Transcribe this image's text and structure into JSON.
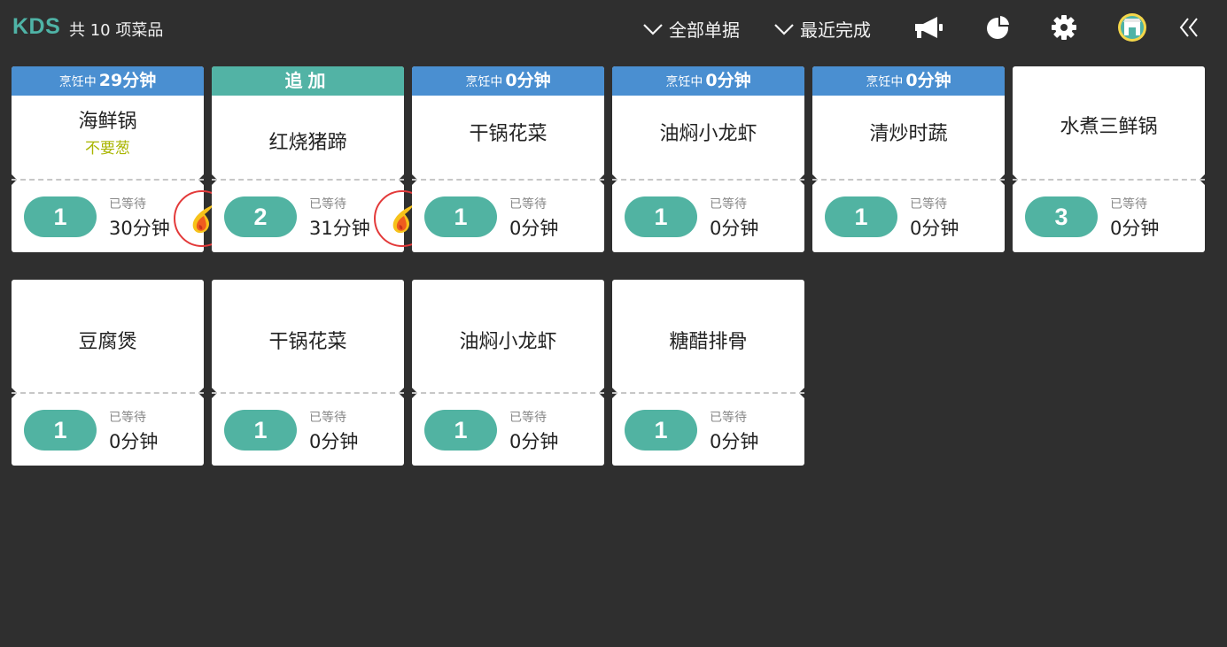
{
  "topbar": {
    "logo": "KDS",
    "count_text": "共 10 项菜品",
    "filter_all": "全部单据",
    "filter_recent": "最近完成",
    "icons": [
      "megaphone-icon",
      "pie-chart-icon",
      "gear-icon",
      "store-icon",
      "double-chevron-left-icon"
    ]
  },
  "colors": {
    "background": "#2f2f2f",
    "cooking_header": "#4a8fd1",
    "add_header": "#52b3a5",
    "quantity_pill": "#51b3a2",
    "note": "#a9b500",
    "flame_ring": "#e33a3a"
  },
  "cards": [
    {
      "header_type": "cooking",
      "header_label": "烹饪中",
      "header_value": "29分钟",
      "dish": "海鲜锅",
      "note": "不要葱",
      "qty": "1",
      "wait_label": "已等待",
      "wait_time": "30分钟",
      "urgent": true
    },
    {
      "header_type": "add",
      "header_text": "追加",
      "dish": "红烧猪蹄",
      "qty": "2",
      "wait_label": "已等待",
      "wait_time": "31分钟",
      "urgent": true
    },
    {
      "header_type": "cooking",
      "header_label": "烹饪中",
      "header_value": "0分钟",
      "dish": "干锅花菜",
      "qty": "1",
      "wait_label": "已等待",
      "wait_time": "0分钟"
    },
    {
      "header_type": "cooking",
      "header_label": "烹饪中",
      "header_value": "0分钟",
      "dish": "油焖小龙虾",
      "qty": "1",
      "wait_label": "已等待",
      "wait_time": "0分钟"
    },
    {
      "header_type": "cooking",
      "header_label": "烹饪中",
      "header_value": "0分钟",
      "dish": "清炒时蔬",
      "qty": "1",
      "wait_label": "已等待",
      "wait_time": "0分钟"
    },
    {
      "header_type": "none",
      "dish": "水煮三鲜锅",
      "qty": "3",
      "wait_label": "已等待",
      "wait_time": "0分钟"
    },
    {
      "header_type": "none",
      "dish": "豆腐煲",
      "qty": "1",
      "wait_label": "已等待",
      "wait_time": "0分钟"
    },
    {
      "header_type": "none",
      "dish": "干锅花菜",
      "qty": "1",
      "wait_label": "已等待",
      "wait_time": "0分钟"
    },
    {
      "header_type": "none",
      "dish": "油焖小龙虾",
      "qty": "1",
      "wait_label": "已等待",
      "wait_time": "0分钟"
    },
    {
      "header_type": "none",
      "dish": "糖醋排骨",
      "qty": "1",
      "wait_label": "已等待",
      "wait_time": "0分钟"
    }
  ]
}
